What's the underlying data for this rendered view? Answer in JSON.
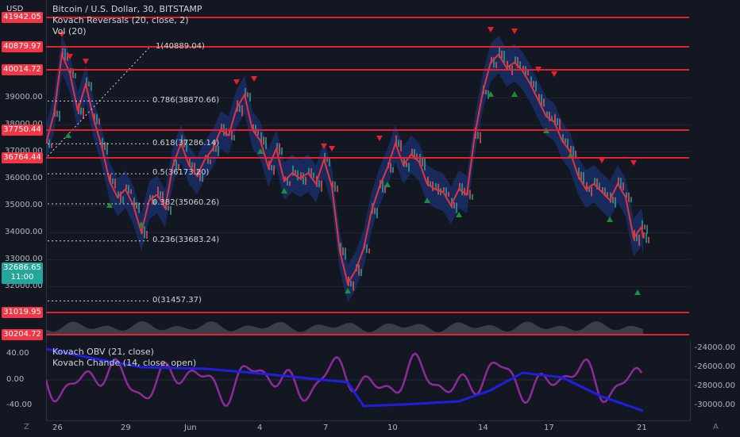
{
  "currency": "USD",
  "legend": {
    "symbol": "Bitcoin / U.S. Dollar, 30, BITSTAMP",
    "indicator1": "Kovach Reversals (20, close, 2)",
    "indicator2": "Vol (20)"
  },
  "osc_legend": {
    "indicator1": "Kovach OBV (21, close)",
    "indicator2": "Kovach Chande (14, close, open)"
  },
  "price_tags": [
    {
      "label": "41942.05",
      "price": 41942.05
    },
    {
      "label": "40879.97",
      "price": 40879.97
    },
    {
      "label": "40014.72",
      "price": 40014.72
    },
    {
      "label": "37750.44",
      "price": 37750.44
    },
    {
      "label": "36764.44",
      "price": 36764.44
    },
    {
      "label": "31019.95",
      "price": 31019.95
    },
    {
      "label": "30204.72",
      "price": 30204.72
    }
  ],
  "current_price": {
    "label": "32686.65",
    "timer": "11:00"
  },
  "price_scale": [
    "39000.00",
    "38000.00",
    "37000.00",
    "36000.00",
    "35000.00",
    "34000.00",
    "33000.00",
    "32000.00"
  ],
  "fib_levels": [
    {
      "label": "1(40889.04)",
      "price": 40889.04
    },
    {
      "label": "0.786(38870.66)",
      "price": 38870.66
    },
    {
      "label": "0.618(37286.14)",
      "price": 37286.14
    },
    {
      "label": "0.5(36173.20)",
      "price": 36173.2
    },
    {
      "label": "0.382(35060.26)",
      "price": 35060.26
    },
    {
      "label": "0.236(33683.24)",
      "price": 33683.24
    },
    {
      "label": "0(31457.37)",
      "price": 31457.37
    }
  ],
  "osc_left_scale": [
    "40.00",
    "0.00",
    "-40.00"
  ],
  "osc_right_scale": [
    "-24000.00",
    "-26000.00",
    "-28000.00",
    "-30000.00"
  ],
  "time_labels": [
    "26",
    "29",
    "Jun",
    "4",
    "7",
    "10",
    "14",
    "17",
    "21"
  ],
  "corner_left": "Z",
  "corner_right": "A",
  "colors": {
    "background": "#131722",
    "level_line": "#e6212c",
    "band": "#1e3a8a",
    "reversal_line": "#e2343f",
    "obv_line": "#1f1fe0",
    "chande_line": "#8e2a9a",
    "up_marker": "#1b8f3a",
    "down_marker": "#e6212c"
  }
}
